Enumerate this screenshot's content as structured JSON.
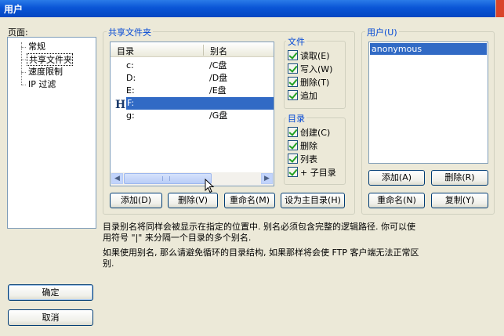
{
  "window": {
    "title": "用户"
  },
  "pages": {
    "label": "页面:",
    "items": [
      "常规",
      "共享文件夹",
      "速度限制",
      "IP 过滤"
    ]
  },
  "shared_folders": {
    "group_title": "共享文件夹",
    "columns": {
      "directory": "目录",
      "alias": "别名"
    },
    "rows": [
      {
        "dir": "c:",
        "alias": "/C盘",
        "selected": false,
        "home": false
      },
      {
        "dir": "D:",
        "alias": "/D盘",
        "selected": false,
        "home": false
      },
      {
        "dir": "E:",
        "alias": "/E盘",
        "selected": false,
        "home": false
      },
      {
        "dir": "F:",
        "alias": "",
        "selected": true,
        "home": true
      },
      {
        "dir": "g:",
        "alias": "/G盘",
        "selected": false,
        "home": false
      }
    ],
    "home_marker": "H",
    "buttons": {
      "add": "添加(D)",
      "remove": "删除(V)",
      "rename": "重命名(M)",
      "set_home": "设为主目录(H)"
    }
  },
  "files": {
    "title": "文件",
    "items": [
      {
        "label": "读取(E)",
        "checked": true
      },
      {
        "label": "写入(W)",
        "checked": true
      },
      {
        "label": "删除(T)",
        "checked": true
      },
      {
        "label": "追加",
        "checked": true
      }
    ]
  },
  "directories": {
    "title": "目录",
    "items": [
      {
        "label": "创建(C)",
        "checked": true
      },
      {
        "label": "删除",
        "checked": true
      },
      {
        "label": "列表",
        "checked": true
      },
      {
        "label": "+ 子目录",
        "checked": true
      }
    ]
  },
  "users": {
    "title": "用户(U)",
    "list": [
      "anonymous"
    ],
    "selected": "anonymous",
    "buttons": {
      "add": "添加(A)",
      "remove": "删除(R)",
      "rename": "重命名(N)",
      "copy": "复制(Y)"
    }
  },
  "help": {
    "line1": "目录别名将同样会被显示在指定的位置中. 别名必须包含完整的逻辑路径. 你可以使",
    "line2": "用符号 \"|\" 来分隔一个目录的多个别名.",
    "line3": "如果使用别名, 那么请避免循环的目录结构, 如果那样将会使 FTP 客户端无法正常区",
    "line4": "别."
  },
  "dialog_buttons": {
    "ok": "确定",
    "cancel": "取消"
  },
  "colors": {
    "title_bar": "#0a55d6",
    "selection": "#316ac5",
    "group_title": "#0046d5"
  }
}
